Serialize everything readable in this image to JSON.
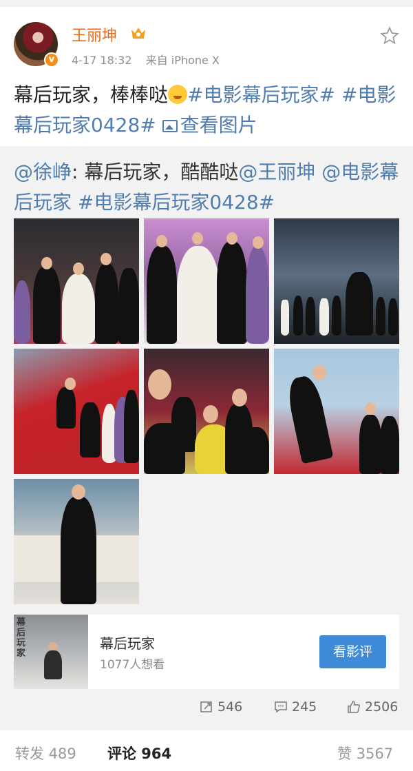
{
  "post": {
    "username": "王丽坤",
    "verified_badge": "v",
    "timestamp": "4-17 18:32",
    "source": "来自 iPhone X",
    "text_plain": "幕后玩家，棒棒哒",
    "tag1": "#电影幕后玩家#",
    "tag2": "#电影幕后玩家0428#",
    "view_images": "查看图片"
  },
  "repost": {
    "author": "@徐峥",
    "text": ": 幕后玩家，酷酷哒",
    "mention1": "@王丽坤",
    "mention2_part1": " @电",
    "mention2_part2": "影幕后玩家",
    "tag": " #电影幕后玩家0428#"
  },
  "movie_card": {
    "poster_title": "幕后玩家",
    "title": "幕后玩家",
    "want_count": "1077人想看",
    "button": "看影评"
  },
  "actions": {
    "repost_count": "546",
    "comment_count": "245",
    "like_count": "2506"
  },
  "bottom_bar": {
    "repost_label": "转发 489",
    "comment_label": "评论 964",
    "like_label": "赞 3567"
  },
  "colors": {
    "username": "#e86b1a",
    "link": "#507daf",
    "button": "#3f8ad6"
  }
}
